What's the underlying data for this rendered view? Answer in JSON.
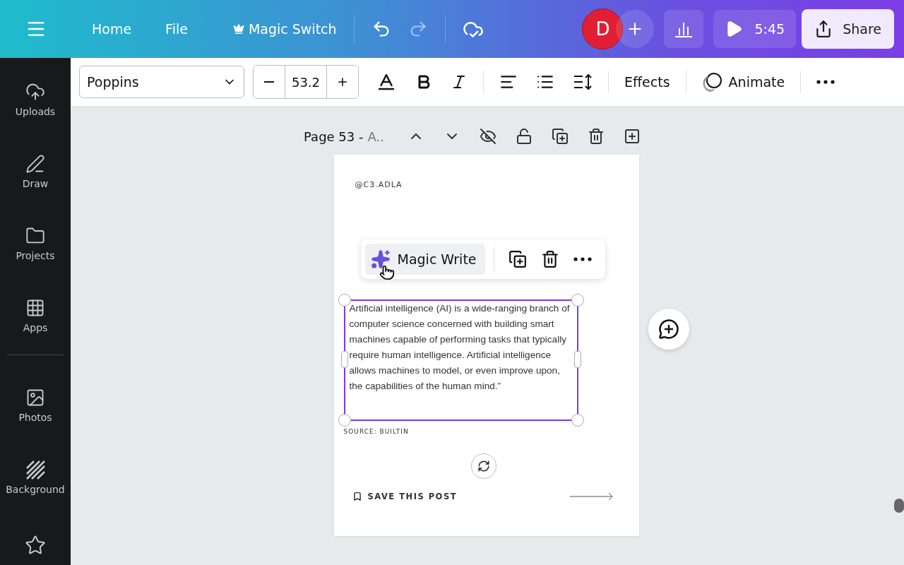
{
  "top_bar": {
    "nav": [
      "Home",
      "File"
    ],
    "magic_switch": "Magic Switch",
    "avatar": "D",
    "timer": "5:45",
    "share": "Share"
  },
  "format_bar": {
    "font": "Poppins",
    "font_size": "53.2",
    "effects": "Effects",
    "animate": "Animate"
  },
  "sidebar": {
    "items": [
      {
        "label": "Uploads",
        "kind": "uploads"
      },
      {
        "label": "Draw",
        "kind": "draw"
      },
      {
        "label": "Projects",
        "kind": "projects"
      },
      {
        "label": "Apps",
        "kind": "apps"
      },
      {
        "label": "Photos",
        "kind": "photos"
      },
      {
        "label": "Background",
        "kind": "background"
      }
    ]
  },
  "page_header": {
    "title": "Page 53 -",
    "subtitle": "A.."
  },
  "design": {
    "handle": "@C3.ADLA",
    "body": "Artificial intelligence (AI) is a wide-ranging branch of computer science concerned with building smart machines capable of performing tasks that typically require human intelligence. Artificial intelligence allows machines to model, or even improve upon, the capabilities of the human mind.”",
    "body_selected": true,
    "source": "SOURCE: BUILTIN",
    "save": "SAVE THIS POST"
  },
  "floating_toolbar": {
    "magic_write": "Magic Write"
  }
}
